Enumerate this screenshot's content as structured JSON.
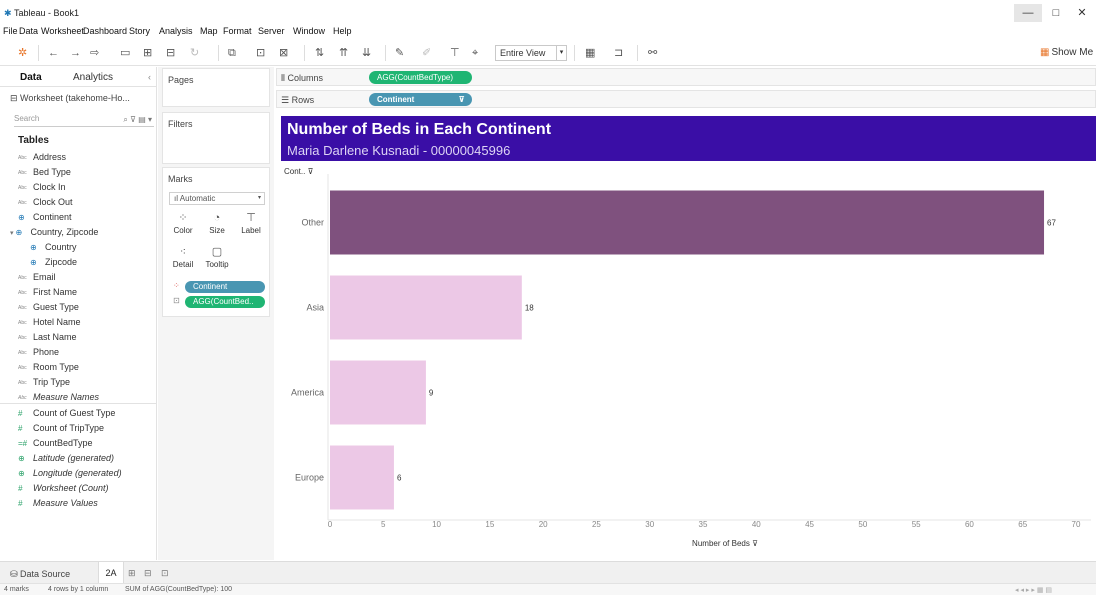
{
  "window": {
    "title": "Tableau - Book1",
    "minimize": "—",
    "maximize": "□",
    "close": "✕"
  },
  "menu": [
    "File",
    "Data",
    "Worksheet",
    "Dashboard",
    "Story",
    "Analysis",
    "Map",
    "Format",
    "Server",
    "Window",
    "Help"
  ],
  "toolbar": {
    "view_mode": "Entire View",
    "show_me": "Show Me"
  },
  "data_pane": {
    "tabs": [
      "Data",
      "Analytics"
    ],
    "datasource": "Worksheet (takehome-Ho...",
    "search_placeholder": "Search",
    "tables_heading": "Tables",
    "dimensions": [
      {
        "type": "Abc",
        "name": "Address"
      },
      {
        "type": "Abc",
        "name": "Bed Type"
      },
      {
        "type": "Abc",
        "name": "Clock In"
      },
      {
        "type": "Abc",
        "name": "Clock Out"
      },
      {
        "type": "⊕",
        "name": "Continent"
      },
      {
        "type": "⊕",
        "name": "Country, Zipcode"
      },
      {
        "type": "⊕",
        "name": "Country"
      },
      {
        "type": "⊕",
        "name": "Zipcode"
      },
      {
        "type": "Abc",
        "name": "Email"
      },
      {
        "type": "Abc",
        "name": "First Name"
      },
      {
        "type": "Abc",
        "name": "Guest Type"
      },
      {
        "type": "Abc",
        "name": "Hotel Name"
      },
      {
        "type": "Abc",
        "name": "Last Name"
      },
      {
        "type": "Abc",
        "name": "Phone"
      },
      {
        "type": "Abc",
        "name": "Room Type"
      },
      {
        "type": "Abc",
        "name": "Trip Type"
      },
      {
        "type": "Abc",
        "name": "Measure Names"
      }
    ],
    "measures": [
      {
        "type": "#",
        "name": "Count of Guest Type"
      },
      {
        "type": "#",
        "name": "Count of TripType"
      },
      {
        "type": "=#",
        "name": "CountBedType"
      },
      {
        "type": "⊕",
        "name": "Latitude (generated)"
      },
      {
        "type": "⊕",
        "name": "Longitude (generated)"
      },
      {
        "type": "#",
        "name": "Worksheet (Count)"
      },
      {
        "type": "#",
        "name": "Measure Values"
      }
    ]
  },
  "cards": {
    "pages": "Pages",
    "filters": "Filters",
    "marks": {
      "title": "Marks",
      "type": "Automatic",
      "buttons": [
        "Color",
        "Size",
        "Label",
        "Detail",
        "Tooltip"
      ],
      "pills": [
        "Continent",
        "AGG(CountBed.."
      ]
    }
  },
  "shelves": {
    "columns_label": "Columns",
    "columns_pill": "AGG(CountBedType)",
    "rows_label": "Rows",
    "rows_pill": "Continent"
  },
  "viz": {
    "title": "Number of Beds in Each Continent",
    "subtitle": "Maria Darlene Kusnadi - 00000045996",
    "row_header": "Cont..",
    "header_bg": "#3a0ea6"
  },
  "chart_data": {
    "type": "bar",
    "orientation": "horizontal",
    "categories": [
      "Other",
      "Asia",
      "America",
      "Europe"
    ],
    "values": [
      67,
      18,
      9,
      6
    ],
    "colors": [
      "#7f517e",
      "#ecc8e6",
      "#ecc8e6",
      "#ecc8e6"
    ],
    "xlabel": "Number of Beds",
    "xlim": [
      0,
      70
    ],
    "xticks": [
      0,
      5,
      10,
      15,
      20,
      25,
      30,
      35,
      40,
      45,
      50,
      55,
      60,
      65,
      70
    ],
    "data_labels": true,
    "grid": false
  },
  "bottom": {
    "data_source_tab": "Data Source",
    "sheet_tab": "2A",
    "status": {
      "marks": "4 marks",
      "rows_cols": "4 rows by 1 column",
      "sum": "SUM of AGG(CountBedType): 100"
    }
  }
}
